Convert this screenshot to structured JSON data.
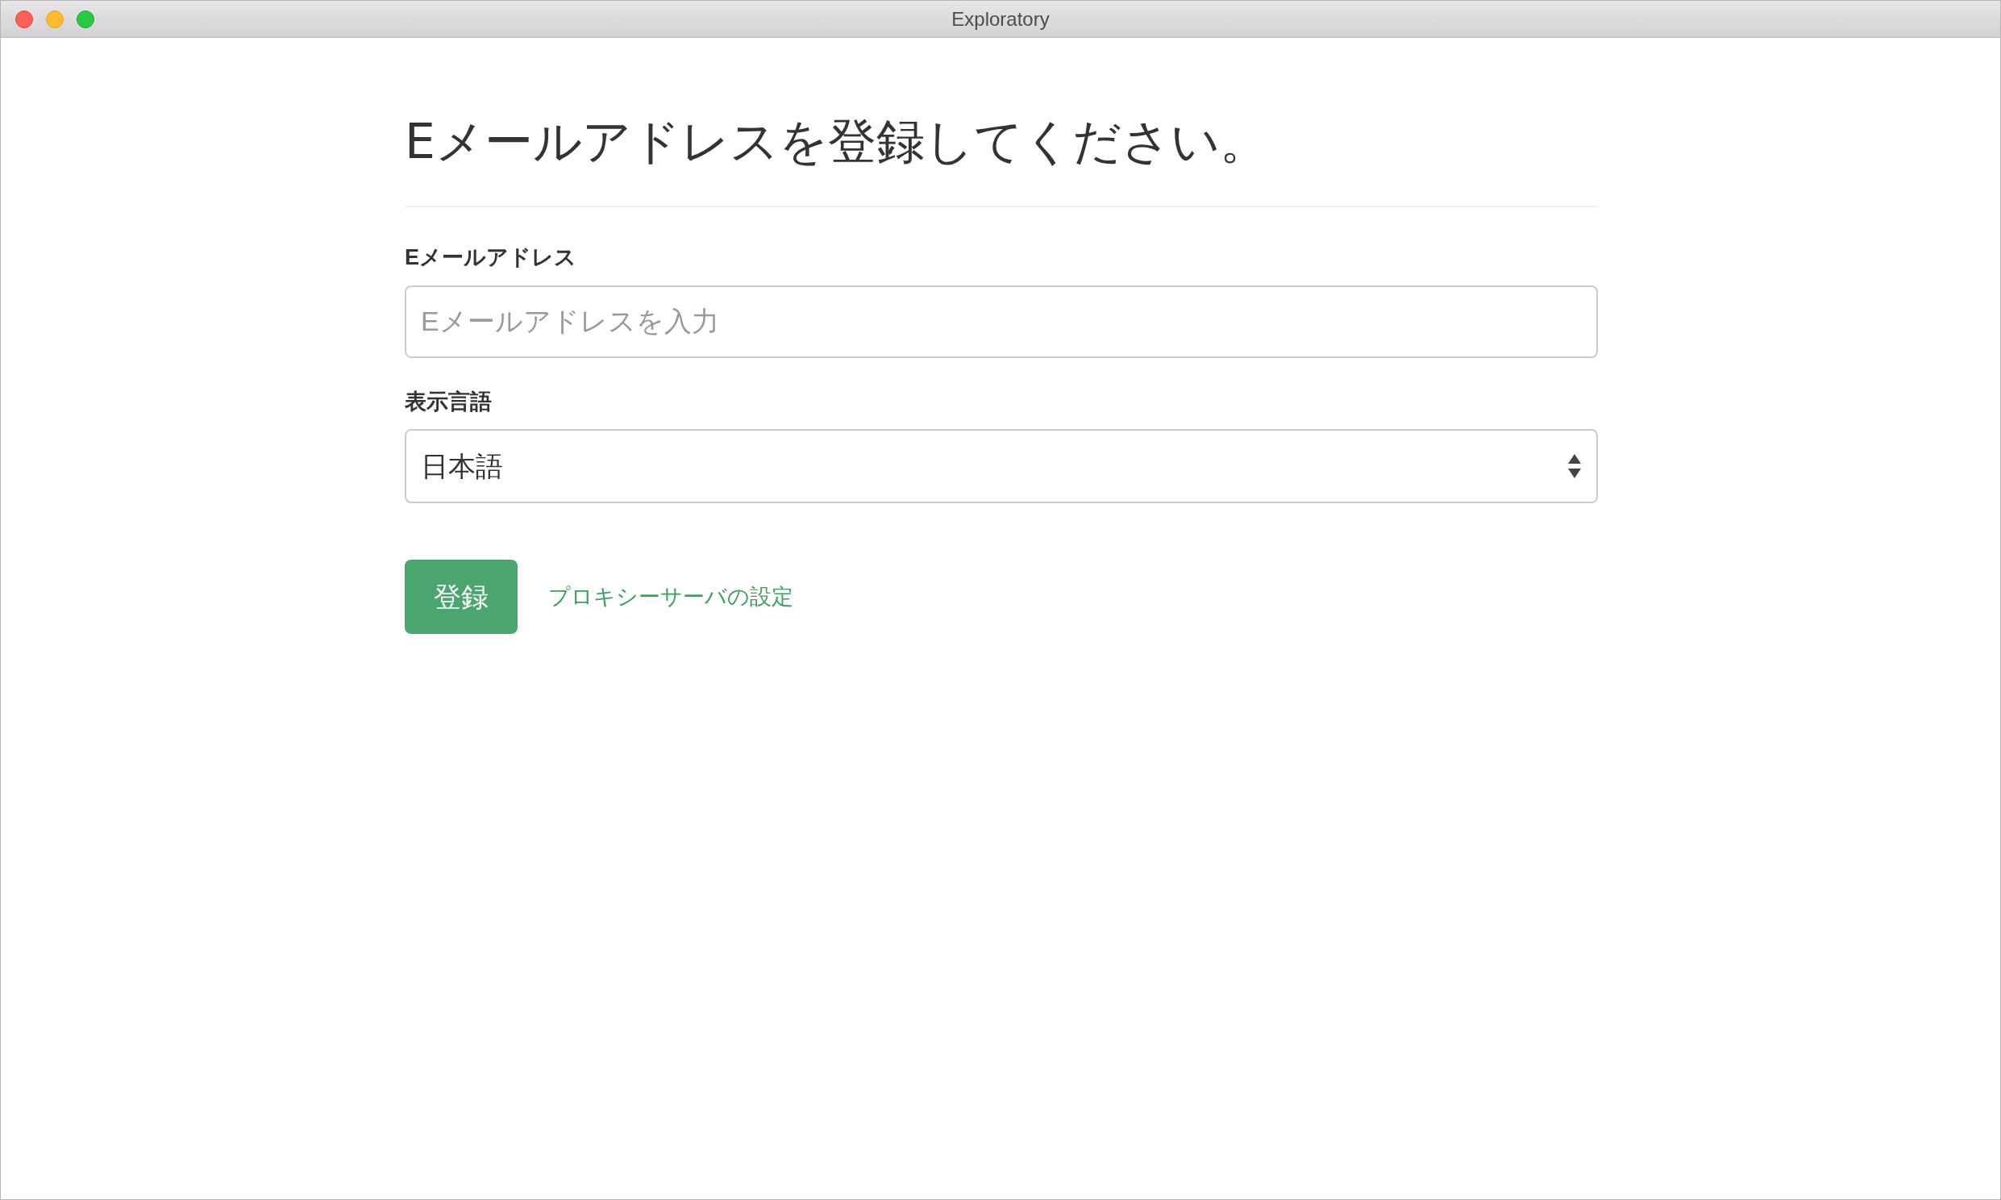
{
  "window": {
    "title": "Exploratory"
  },
  "heading": "Eメールアドレスを登録してください。",
  "email": {
    "label": "Eメールアドレス",
    "placeholder": "Eメールアドレスを入力"
  },
  "language": {
    "label": "表示言語",
    "value": "日本語"
  },
  "register_button": "登録",
  "proxy_link": "プロキシーサーバの設定"
}
